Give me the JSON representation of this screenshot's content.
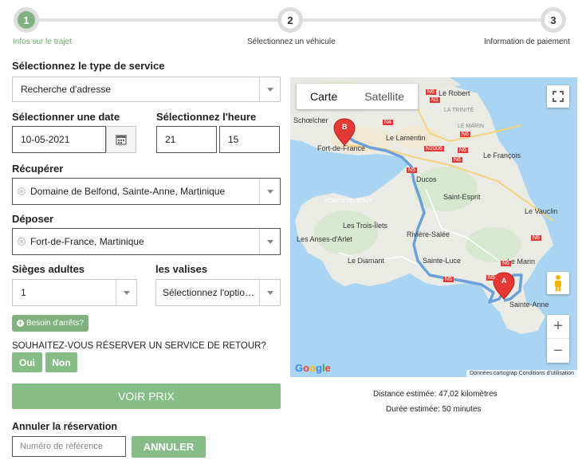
{
  "steps": [
    {
      "number": "1",
      "label": "Infos sur le trajet"
    },
    {
      "number": "2",
      "label": "Sélectionnez un véhicule"
    },
    {
      "number": "3",
      "label": "Information de paiement"
    }
  ],
  "form": {
    "service_type_label": "Sélectionnez le type de service",
    "service_type_value": "Recherche d'adresse",
    "date_label": "Sélectionner une date",
    "date_value": "10-05-2021",
    "time_label": "Sélectionnez l'heure",
    "hour_value": "21",
    "minute_value": "15",
    "pickup_label": "Récupérer",
    "pickup_value": "Domaine de Belfond, Sainte-Anne, Martinique",
    "dropoff_label": "Déposer",
    "dropoff_value": "Fort-de-France, Martinique",
    "seats_label": "Sièges adultes",
    "seats_value": "1",
    "luggage_label": "les valises",
    "luggage_value": "Sélectionnez l'option ...",
    "stops_button": "Besoin d'arrêts?",
    "return_question": "SOUHAITEZ-VOUS RÉSERVER UN SERVICE DE RETOUR?",
    "yes_button": "Oui",
    "no_button": "Non",
    "price_button": "VOIR PRIX",
    "cancel_label": "Annuler la réservation",
    "reference_placeholder": "Numéro de référence",
    "cancel_button": "ANNULER"
  },
  "map": {
    "tab_map": "Carte",
    "tab_satellite": "Satellite",
    "logo": "Google",
    "attribution": "Données cartograp",
    "terms": "Conditions d'utilisation",
    "marker_a": "A",
    "marker_b": "B",
    "places": {
      "le_robert": "Le Robert",
      "schoelcher": "Schœlcher",
      "fort_de_france": "Fort-de-France",
      "le_lamentin": "Le Lamentin",
      "le_francois": "Le François",
      "ducos": "Ducos",
      "sainte_esprit": "Saint-Esprit",
      "le_vauclin": "Le Vauclin",
      "pointe_du_bout": "POINTE DU BOUT",
      "les_trois_ilets": "Les Trois-Îlets",
      "riviere_salee": "Rivière-Salée",
      "les_anses_darlet": "Les Anses-d'Arlet",
      "le_diamant": "Le Diamant",
      "sainte_luce": "Sainte-Luce",
      "le_marin": "Le Marin",
      "sainte_anne": "Sainte-Anne",
      "la_trinite": "LA TRINITÉ",
      "le_marin_upper": "LE MARIN"
    },
    "road_labels": [
      "N1",
      "N6",
      "N2006",
      "N6",
      "N6",
      "N5",
      "N4",
      "N5",
      "N6",
      "N5",
      "N6",
      "N6"
    ]
  },
  "trip": {
    "distance": "Distance estimée: 47,02 kilomètres",
    "duration": "Durée estimée: 50 minutes"
  },
  "colors": {
    "accent_green": "#86bd86",
    "route_blue": "#6aa1d8",
    "marker_red": "#e53935"
  }
}
